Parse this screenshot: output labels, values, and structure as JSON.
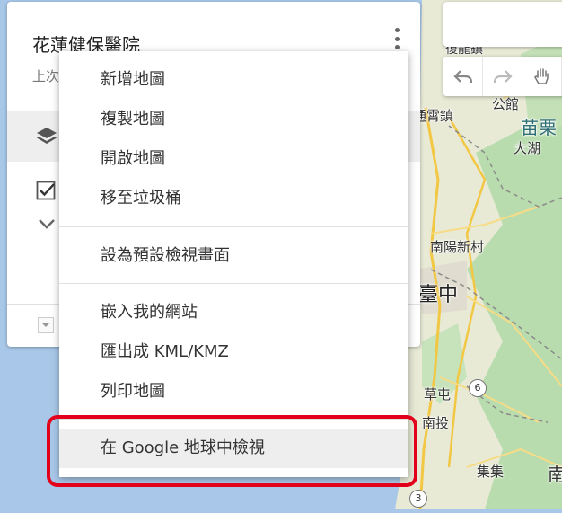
{
  "panel": {
    "title": "花蓮健保醫院",
    "subtitle": "上次"
  },
  "map_labels": {
    "fuliu": "復龍鎮",
    "gongguan": "公館",
    "miaoli": "苗栗",
    "tonghsiao": "通霄鎮",
    "dahu": "大湖",
    "nanyang": "南陽新村",
    "taichung": "臺中",
    "caotun": "草屯",
    "nantou": "南投",
    "jiji": "集集",
    "nan_partial": "南"
  },
  "route_badges": {
    "r6": "6",
    "r3": "3"
  },
  "menu": {
    "new_map": "新增地圖",
    "copy_map": "複製地圖",
    "open_map": "開啟地圖",
    "trash": "移至垃圾桶",
    "set_default_view": "設為預設檢視畫面",
    "embed": "嵌入我的網站",
    "export_kml": "匯出成 KML/KMZ",
    "print": "列印地圖",
    "google_earth": "在 Google 地球中檢視"
  },
  "colors": {
    "highlight": "#e3001b",
    "menu_hover": "#eeeeee",
    "water": "#a9c8e9",
    "land": "#e8ead6",
    "green": "#b9dcae"
  },
  "icons": {
    "layers": "layers-icon",
    "check": "checkbox-icon",
    "chevron": "chevron-down-icon",
    "undo": "undo-icon",
    "redo": "redo-icon",
    "hand": "hand-icon",
    "kebab": "more-vert-icon"
  }
}
